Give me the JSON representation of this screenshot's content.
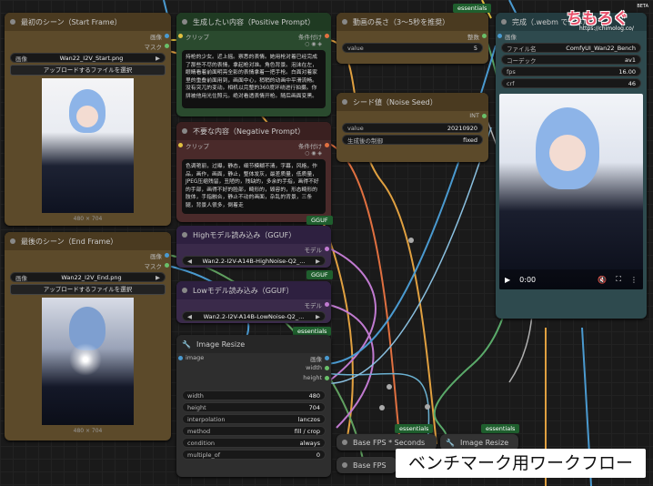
{
  "nodes": {
    "first_scene": {
      "title": "最初のシーン（Start Frame）",
      "out_image": "画像",
      "out_mask": "マスク",
      "image_value": "Wan22_I2V_Start.png",
      "image_label": "画像",
      "upload": "アップロードするファイルを選択",
      "size": "480 × 704"
    },
    "last_scene": {
      "title": "最後のシーン（End Frame）",
      "out_image": "画像",
      "out_mask": "マスク",
      "image_value": "Wan22_I2V_End.png",
      "image_label": "画像",
      "upload": "アップロードするファイルを選択",
      "size": "480 × 704"
    },
    "positive": {
      "title": "生成したい内容（Positive Prompt）",
      "in_clip": "クリップ",
      "out_cond": "条件付け",
      "text": "持枪的少女。近上摇。察悉的表情。她用枪对着已经完成了那些不尽的表情，拿起枪对准。角色背景。泡沫在左，眼睛看着前面明亮全影的表情拿着一把手枪。白面对着家里的重叠前面用到，画面中心，稍稍的动画中平滑流畅。没有突兀的变动。相机以完整的360度环绕进行拍摄。你拼被他用光住照元。绝对看透表情开枪。随后画面变黑。"
    },
    "negative": {
      "title": "不要な内容（Negative Prompt）",
      "in_clip": "クリップ",
      "out_cond": "条件付け",
      "text": "色调艳丽，过曝，静态，细节模糊不清，字幕，风格，作品，画作，画面，静止，整体发灰，最差质量，低质量，JPEG压缩残留，丑陋的，残缺的，多余的手指，画得不好的手部，画得不好的脸部，畸形的，毁容的，形态畸形的肢体，手指融合，静止不动的画面，杂乱的背景，三条腿，背景人很多，倒着走"
    },
    "duration": {
      "title": "動画の長さ（3〜5秒を推奨）",
      "out_int": "整数",
      "value_label": "value",
      "value": "5"
    },
    "seed": {
      "title": "シード値（Noise Seed）",
      "out_int": "INT",
      "value_label": "value",
      "value": "20210920",
      "control_label": "生成後の制御",
      "control_value": "fixed"
    },
    "complete": {
      "title": "完成（.webm で保存）",
      "in_image": "画像",
      "filename_label": "ファイル名",
      "filename": "ComfyUI_Wan22_Bench",
      "codec_label": "コーデック",
      "codec": "av1",
      "fps_label": "fps",
      "fps": "16.00",
      "crf_label": "crf",
      "crf": "46",
      "time": "0:00"
    },
    "high_model": {
      "title": "Highモデル読み込み（GGUF）",
      "out": "モデル",
      "value": "Wan2.2-I2V-A14B-HighNoise-Q2_..."
    },
    "low_model": {
      "title": "Lowモデル読み込み（GGUF）",
      "out": "モデル",
      "value": "Wan2.2-I2V-A14B-LowNoise-Q2_..."
    },
    "resize": {
      "title": "Image Resize",
      "in_image": "image",
      "out_image": "画像",
      "out_width": "width",
      "out_height": "height",
      "widgets": [
        {
          "label": "width",
          "value": "480"
        },
        {
          "label": "height",
          "value": "704"
        },
        {
          "label": "interpolation",
          "value": "lanczos"
        },
        {
          "label": "method",
          "value": "fill / crop"
        },
        {
          "label": "condition",
          "value": "always"
        },
        {
          "label": "multiple_of",
          "value": "0"
        }
      ]
    },
    "base_fps": {
      "title": "Base FPS * Seconds"
    },
    "image_resize2": {
      "title": "Image Resize"
    },
    "base_fps2": {
      "title": "Base FPS"
    }
  },
  "tags": {
    "gguf": "GGUF",
    "essentials": "essentials"
  },
  "watermark": {
    "logo": "ちもろぐ",
    "beta": "BETA",
    "url": "https://chimolog.co/"
  },
  "caption": "ベンチマーク用ワークフロー"
}
